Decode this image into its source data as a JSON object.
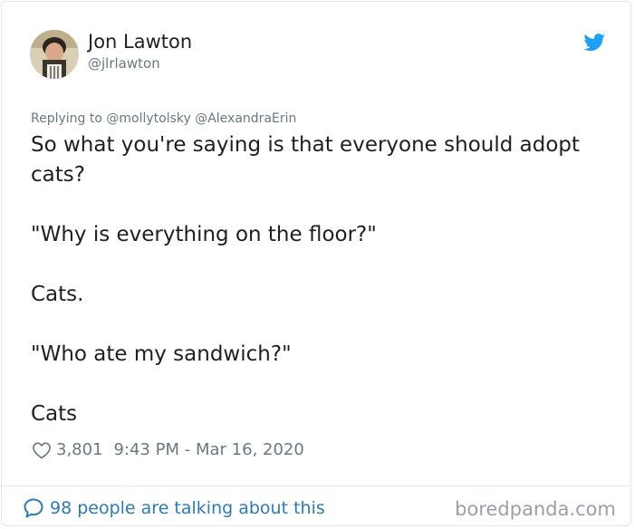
{
  "tweet": {
    "author_name": "Jon Lawton",
    "author_handle": "@jlrlawton",
    "replying_to": "Replying to @mollytolsky @AlexandraErin",
    "paragraphs": [
      "So what you're saying is that everyone should adopt cats?",
      "\"Why is everything on the floor?\"",
      "Cats.",
      "\"Who ate my sandwich?\"",
      "Cats"
    ],
    "likes": "3,801",
    "timestamp": "9:43 PM - Mar 16, 2020",
    "talking": "98 people are talking about this"
  },
  "watermark": "boredpanda.com",
  "icons": {
    "brand": "twitter-bird-icon",
    "like": "heart-icon",
    "comment": "speech-bubble-icon"
  },
  "colors": {
    "twitter_blue": "#1da1f2",
    "link_blue": "#2b7bb9",
    "muted_text": "#697882",
    "body_text": "#1c2022"
  }
}
